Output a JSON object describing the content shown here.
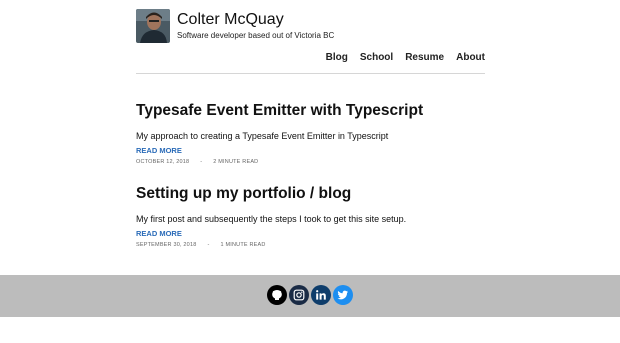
{
  "site": {
    "title": "Colter McQuay",
    "description": "Software developer based out of Victoria BC"
  },
  "nav": {
    "items": [
      "Blog",
      "School",
      "Resume",
      "About"
    ]
  },
  "posts": [
    {
      "title": "Typesafe Event Emitter with Typescript",
      "excerpt": "My approach to creating a Typesafe Event Emitter in Typescript",
      "read_more": "READ MORE",
      "date": "OCTOBER 12, 2018",
      "separator": "-",
      "read_time": "2 MINUTE READ"
    },
    {
      "title": "Setting up my portfolio / blog",
      "excerpt": "My first post and subsequently the steps I took to get this site setup.",
      "read_more": "READ MORE",
      "date": "SEPTEMBER 30, 2018",
      "separator": "-",
      "read_time": "1 MINUTE READ"
    }
  ],
  "footer": {
    "socials": [
      {
        "icon": "github-icon",
        "color": "#000000"
      },
      {
        "icon": "instagram-icon",
        "color": "#1a2b45"
      },
      {
        "icon": "linkedin-icon",
        "color": "#0e3d6b"
      },
      {
        "icon": "twitter-icon",
        "color": "#1d8ef0"
      }
    ]
  },
  "colors": {
    "link": "#2a6bb8",
    "footer_bg": "#bcbcbc",
    "divider": "#d6d6d6"
  }
}
